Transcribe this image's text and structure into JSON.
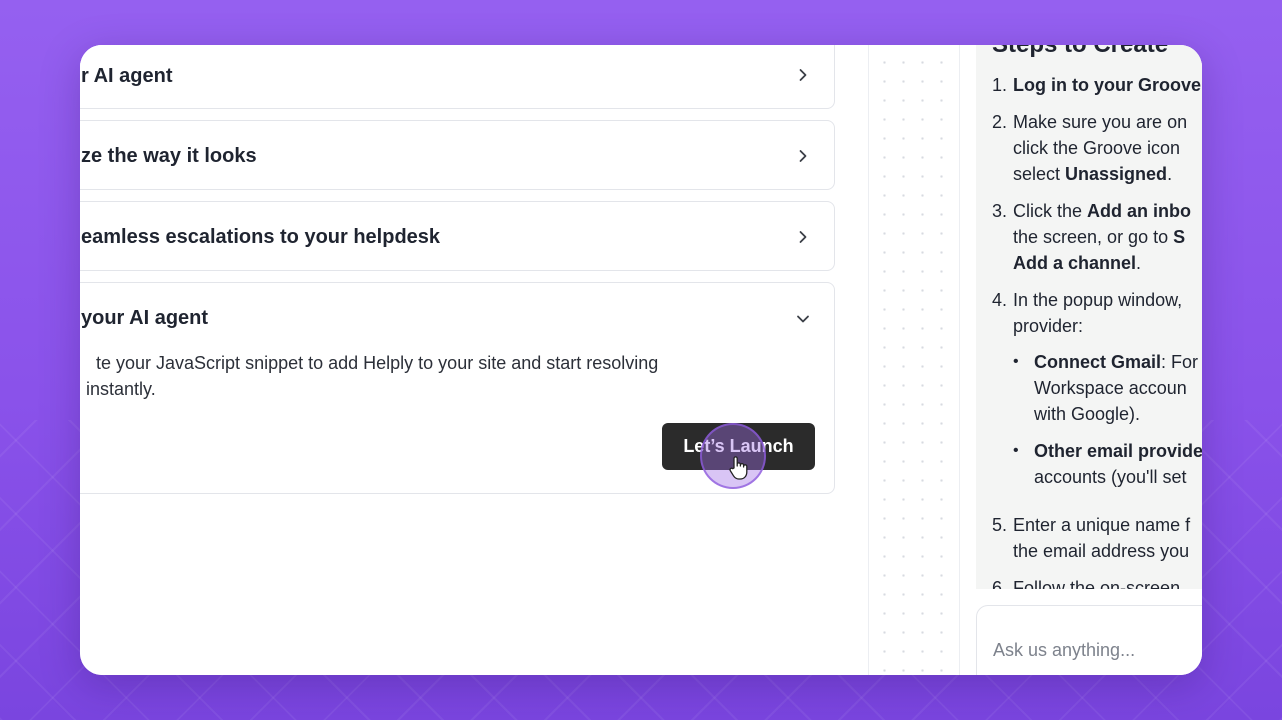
{
  "accordion": {
    "items": [
      {
        "title": "r AI agent",
        "expanded": false
      },
      {
        "title": "ze the way it looks",
        "expanded": false
      },
      {
        "title": "eamless escalations to your helpdesk",
        "expanded": false
      },
      {
        "title": "your AI agent",
        "expanded": true,
        "body_line1": "te your JavaScript snippet to add Helply to your site and start resolving",
        "body_line2": " instantly.",
        "button_label": "Let’s Launch"
      }
    ]
  },
  "steps": {
    "title": "Steps to Create",
    "items": [
      {
        "num": "1.",
        "parts": [
          {
            "b": "Log in to your Groove"
          }
        ]
      },
      {
        "num": "2.",
        "parts": [
          {
            "t": "Make sure you are on"
          },
          {
            "br": true
          },
          {
            "t": "click the Groove icon"
          },
          {
            "br": true
          },
          {
            "t": "select "
          },
          {
            "b": "Unassigned"
          },
          {
            "t": "."
          }
        ]
      },
      {
        "num": "3.",
        "parts": [
          {
            "t": "Click the "
          },
          {
            "b": "Add an inbo"
          },
          {
            "br": true
          },
          {
            "t": "the screen, or go to "
          },
          {
            "b": "S"
          },
          {
            "br": true
          },
          {
            "b": "Add a channel"
          },
          {
            "t": "."
          }
        ]
      },
      {
        "num": "4.",
        "parts": [
          {
            "t": "In the popup window,"
          },
          {
            "br": true
          },
          {
            "t": "provider:"
          }
        ],
        "sub": [
          {
            "parts": [
              {
                "b": "Connect Gmail"
              },
              {
                "t": ": For"
              },
              {
                "br": true
              },
              {
                "t": "Workspace accoun"
              },
              {
                "br": true
              },
              {
                "t": "with Google)."
              }
            ]
          },
          {
            "parts": [
              {
                "b": "Other email provide"
              },
              {
                "br": true
              },
              {
                "t": "accounts (you'll set"
              }
            ]
          }
        ]
      },
      {
        "num": "5.",
        "parts": [
          {
            "t": "Enter a unique name f"
          },
          {
            "br": true
          },
          {
            "t": "the email address you"
          }
        ]
      },
      {
        "num": "6.",
        "parts": [
          {
            "t": "Follow the on-screen"
          }
        ]
      }
    ]
  },
  "chat": {
    "placeholder": "Ask us anything..."
  },
  "icons": {
    "chevron": "chevron-right-icon",
    "chevron_open": "chevron-down-icon",
    "cursor": "hand-pointer-icon"
  },
  "colors": {
    "background": "#8f58ee",
    "button": "#2b2b2b",
    "cursor_ring": "#a06ee6"
  }
}
